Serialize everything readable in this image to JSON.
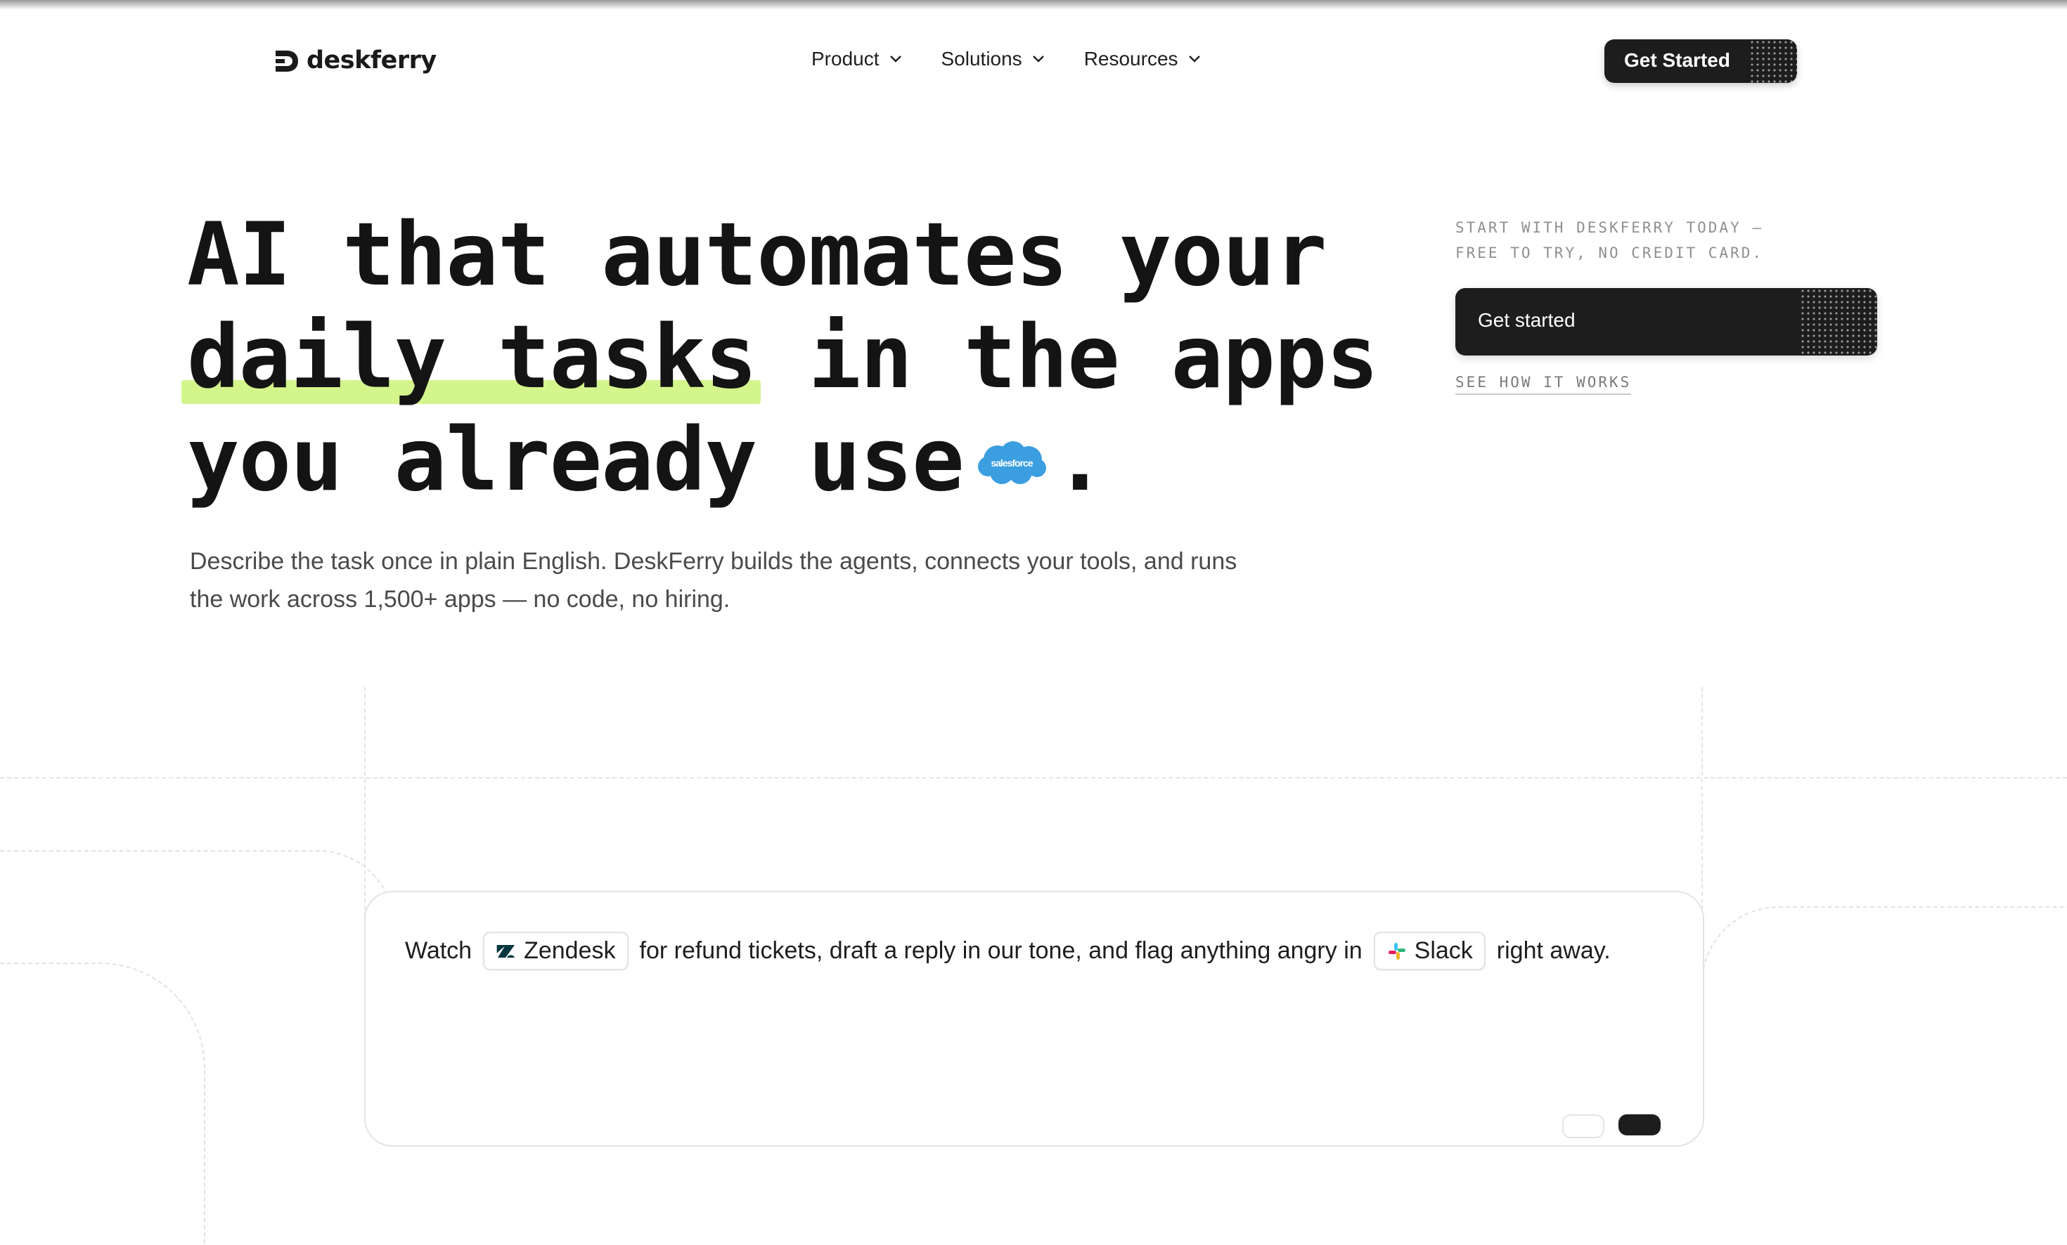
{
  "brand": {
    "name": "deskferry"
  },
  "nav": {
    "items": [
      {
        "label": "Product"
      },
      {
        "label": "Solutions"
      },
      {
        "label": "Resources"
      }
    ],
    "cta_label": "Get Started"
  },
  "hero": {
    "headline_lines": {
      "line1": "AI that automates your",
      "line2_highlight": "daily tasks",
      "line2_rest": " in the apps",
      "line3": "you already use",
      "line3_end": "."
    },
    "inline_logo_text": "salesforce",
    "subtitle": "Describe the task once in plain English. DeskFerry builds the agents, connects your tools, and runs the work across 1,500+ apps — no code, no hiring.",
    "side_caption": {
      "line1": "START WITH DESKFERRY TODAY —",
      "line2": "FREE TO TRY, NO CREDIT CARD."
    },
    "cta_label": "Get started",
    "secondary_link": "SEE HOW IT WORKS"
  },
  "prompt_card": {
    "t1": "Watch",
    "app1": "Zendesk",
    "t2": "for refund tickets, draft a reply in our tone, and flag anything angry in",
    "app2": "Slack",
    "t3": "right away."
  },
  "colors": {
    "accent_highlight": "#d4f58c",
    "button_dark": "#1d1d1d",
    "salesforce_blue": "#3a9ee0",
    "zendesk": "#03363d"
  }
}
